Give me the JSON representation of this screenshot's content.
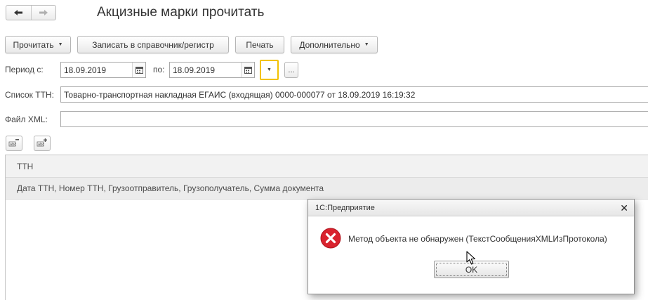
{
  "window": {
    "title": "Акцизные марки прочитать"
  },
  "nav": {
    "back_icon": "arrow-left-icon",
    "forward_icon": "arrow-right-icon"
  },
  "toolbar": {
    "read_label": "Прочитать",
    "write_label": "Записать в справочник/регистр",
    "print_label": "Печать",
    "more_label": "Дополнительно"
  },
  "period": {
    "from_label": "Период с:",
    "from_value": "18.09.2019",
    "to_label": "по:",
    "to_value": "18.09.2019",
    "ellipsis": "..."
  },
  "ttn": {
    "label": "Список ТТН:",
    "value": "Товарно-транспортная накладная ЕГАИС (входящая) 0000-000077 от 18.09.2019 16:19:32"
  },
  "xml": {
    "label": "Файл XML:",
    "value": ""
  },
  "table": {
    "column_header": "ТТН",
    "sub_header": "Дата ТТН, Номер ТТН, Грузоотправитель, Грузополучатель, Сумма документа"
  },
  "dialog": {
    "title": "1С:Предприятие",
    "message": "Метод объекта не обнаружен (ТекстСообщенияXMLИзПротокола)",
    "ok_label": "OK",
    "icon": "error-icon"
  },
  "colors": {
    "accent_border": "#f2c200",
    "error_red": "#d9232e",
    "border_gray": "#a9a9a9"
  }
}
